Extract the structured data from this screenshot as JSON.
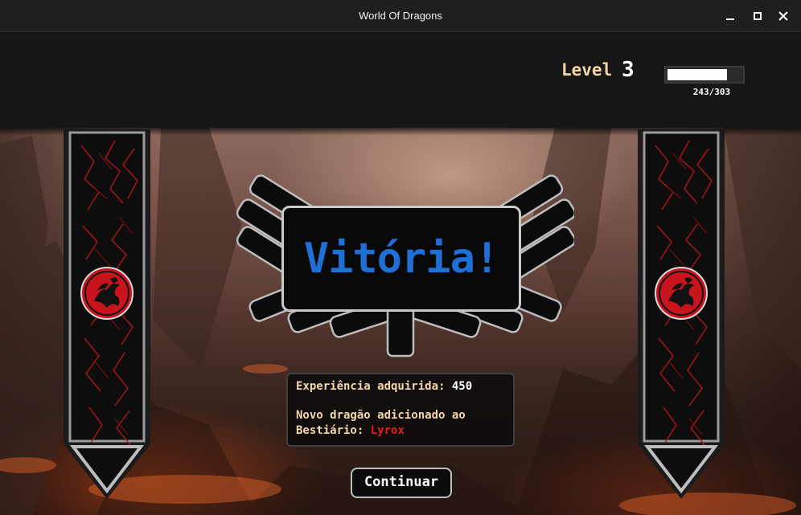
{
  "window": {
    "title": "World Of Dragons"
  },
  "header": {
    "level_label": "Level",
    "level_value": "3",
    "xp_text": "243/303",
    "xp_fraction": 0.8
  },
  "victory": {
    "title": "Vitória!"
  },
  "results": {
    "xp_label": "Experiência adquirida:",
    "xp_value": "450",
    "dragon_line1": "Novo dragão adicionado ao",
    "dragon_label": "Bestiário:",
    "dragon_name": "Lyrox"
  },
  "actions": {
    "continue_label": "Continuar"
  },
  "colors": {
    "accent_blue": "#1e6fd6",
    "label_cream": "#f3d7a8",
    "dragon_red": "#e02020",
    "banner_crest": "#c8141c"
  },
  "icons": {
    "minimize": "minimize-icon",
    "maximize": "maximize-icon",
    "close": "close-icon",
    "crest": "targaryen-dragon-crest-icon"
  }
}
